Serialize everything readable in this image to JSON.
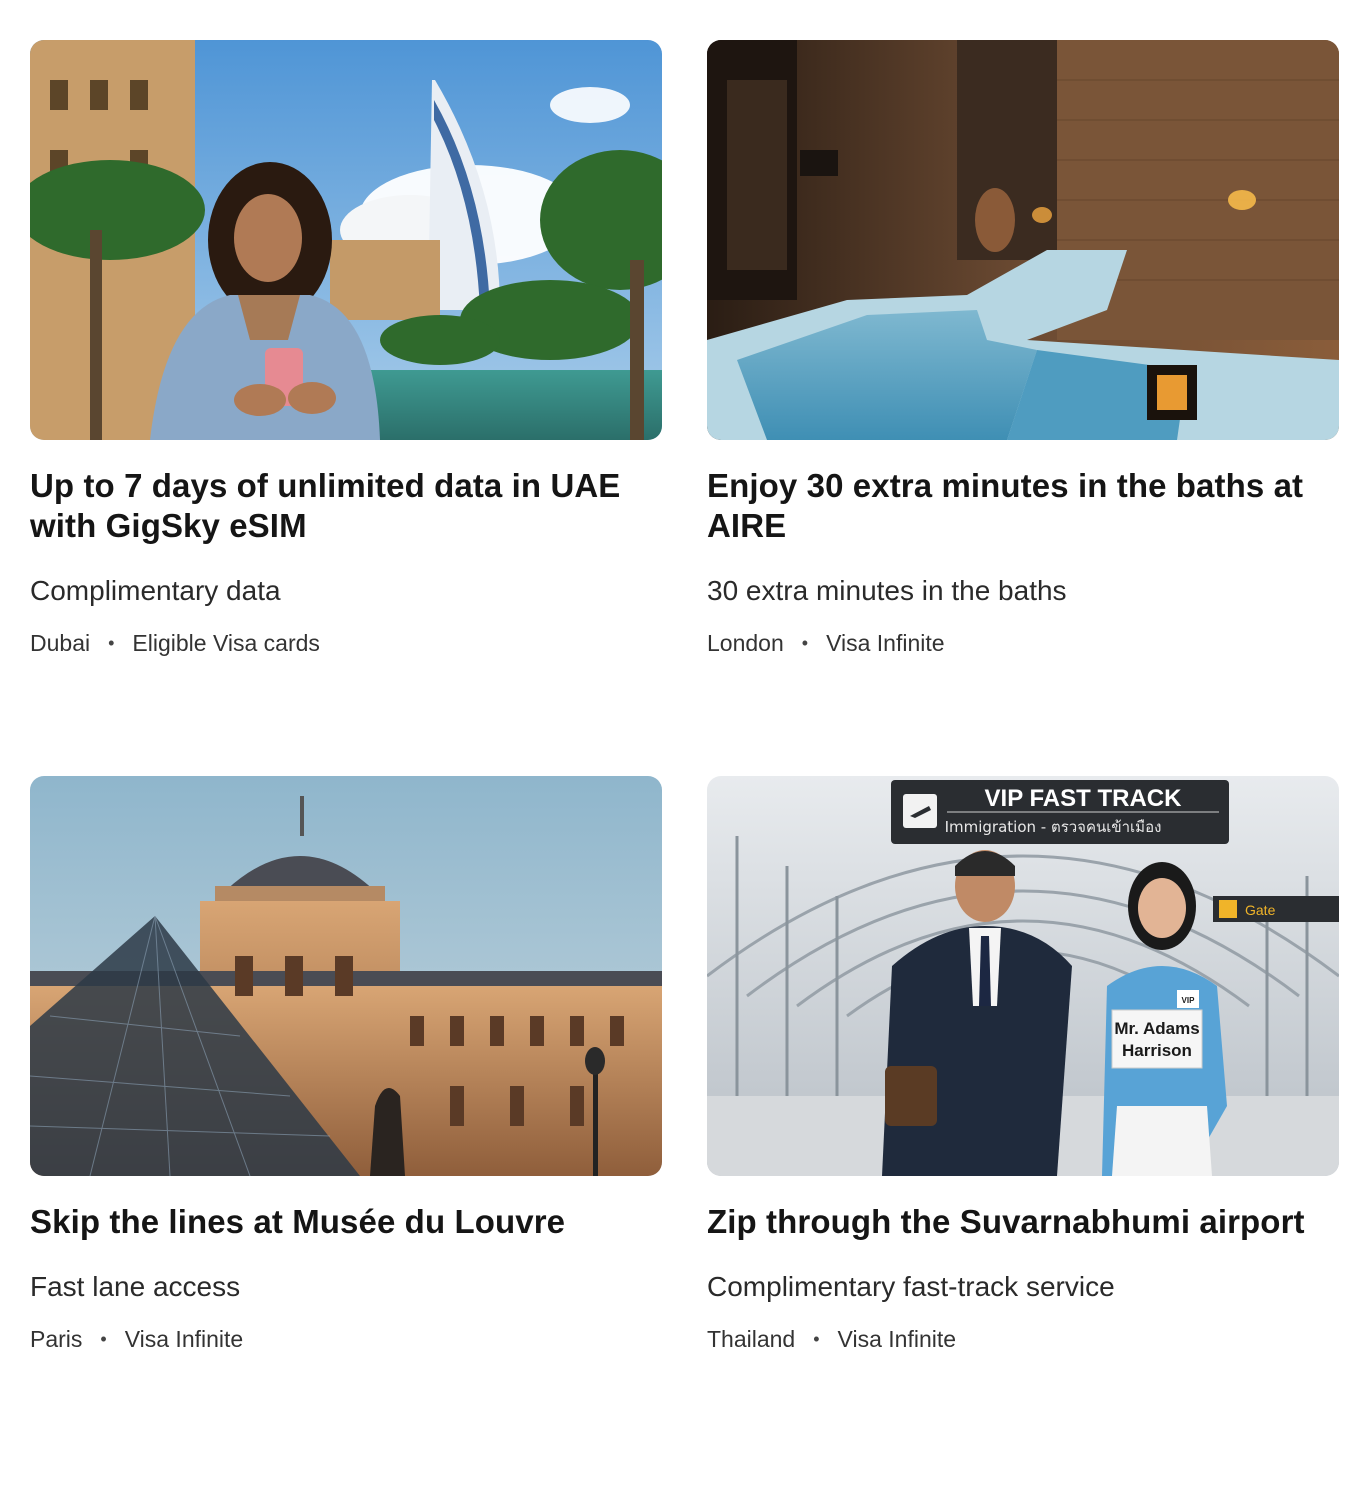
{
  "cards": [
    {
      "title": "Up to 7 days of unlimited data in UAE with GigSky eSIM",
      "subtitle": "Complimentary data",
      "location": "Dubai",
      "separator": "•",
      "eligibility": "Eligible Visa cards",
      "image": "dubai-woman-phone-burj-al-arab-photo"
    },
    {
      "title": "Enjoy 30 extra minutes in the baths at AIRE",
      "subtitle": "30 extra minutes in the baths",
      "location": "London",
      "separator": "•",
      "eligibility": "Visa Infinite",
      "image": "aire-ancient-baths-photo"
    },
    {
      "title": "Skip the lines at Musée du Louvre",
      "subtitle": "Fast lane access",
      "location": "Paris",
      "separator": "•",
      "eligibility": "Visa Infinite",
      "image": "louvre-pyramid-photo"
    },
    {
      "title": "Zip through the Suvarnabhumi airport",
      "subtitle": "Complimentary fast-track service",
      "location": "Thailand",
      "separator": "•",
      "eligibility": "Visa Infinite",
      "image": "airport-vip-fast-track-photo",
      "image_sign": {
        "heading": "VIP FAST TRACK",
        "subheading": "Immigration - ตรวจคนเข้าเมือง",
        "gate": "Gate",
        "name_card": [
          "Mr. Adams",
          "Harrison"
        ],
        "badge": "VIP"
      }
    }
  ]
}
